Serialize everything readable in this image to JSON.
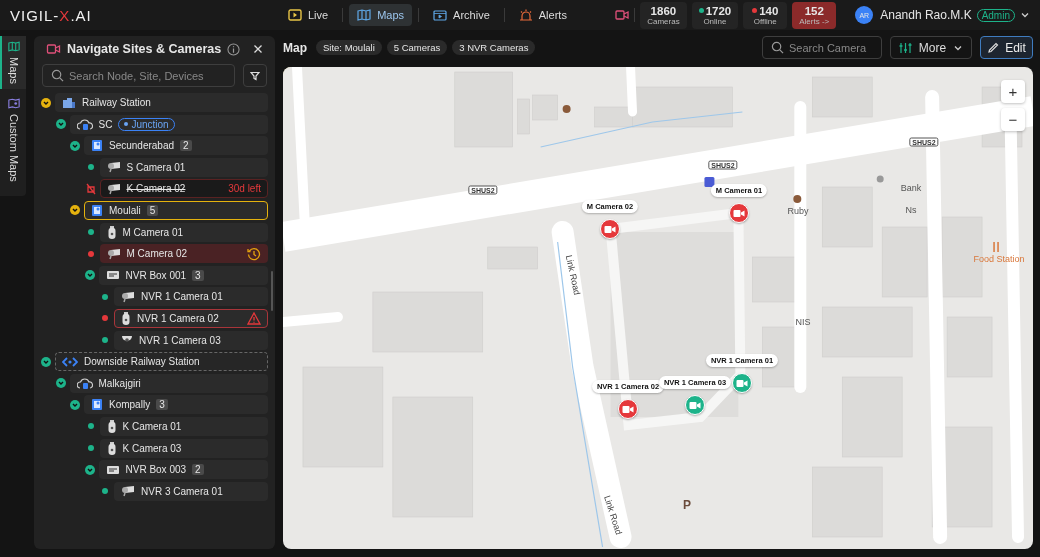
{
  "logo": {
    "before": "VIGIL-",
    "accent": "X",
    "after": ".AI"
  },
  "nav": [
    {
      "label": "Live",
      "kind": "live",
      "selected": false
    },
    {
      "label": "Maps",
      "kind": "maps",
      "selected": true
    },
    {
      "label": "Archive",
      "kind": "archive",
      "selected": false
    },
    {
      "label": "Alerts",
      "kind": "alerts",
      "selected": false
    }
  ],
  "stats": [
    {
      "value": "1860",
      "label": "Cameras",
      "kind": "total"
    },
    {
      "value": "1720",
      "label": "Online",
      "kind": "online",
      "color": "#1db38a"
    },
    {
      "value": "140",
      "label": "Offline",
      "kind": "offline",
      "color": "#e5383b"
    },
    {
      "value": "152",
      "label": "Alerts ->",
      "kind": "alerts"
    }
  ],
  "user": {
    "initials": "AR",
    "name": "Anandh Rao.M.K",
    "role": "Admin"
  },
  "rail": [
    {
      "label": "Maps",
      "kind": "maps",
      "selected": true
    },
    {
      "label": "Custom Maps",
      "kind": "custom",
      "selected": false
    }
  ],
  "panel": {
    "title": "Navigate Sites & Cameras",
    "search_placeholder": "Search Node, Site, Devices"
  },
  "tree": [
    {
      "label": "Railway Station",
      "kind": "building",
      "expanded": true,
      "selected": false,
      "color": "#e5b20e",
      "children": [
        {
          "label": "SC",
          "kind": "cloud",
          "tag": "Junction",
          "expanded": true,
          "selected": false,
          "color": "#1db38a",
          "children": [
            {
              "label": "Secunderabad",
              "kind": "zone",
              "count": "2",
              "expanded": true,
              "selected": false,
              "color": "#1db38a",
              "children": [
                {
                  "label": "S Camera 01",
                  "kind": "bullet",
                  "online": true,
                  "disabled": false,
                  "history_alert": false,
                  "warning": false,
                  "selected": false
                },
                {
                  "label": "K Camera 02",
                  "kind": "bullet",
                  "disabled": true,
                  "history_alert": false,
                  "warning": false,
                  "note": "30d left",
                  "selected": false
                }
              ]
            },
            {
              "label": "Moulali",
              "kind": "zone",
              "count": "5",
              "expanded": true,
              "selected": true,
              "color": "#e5b20e",
              "children": [
                {
                  "label": "M Camera 01",
                  "kind": "ptz",
                  "online": true,
                  "disabled": false,
                  "history_alert": false,
                  "warning": false,
                  "selected": false
                },
                {
                  "label": "M Camera 02",
                  "kind": "bullet",
                  "online": false,
                  "disabled": false,
                  "history_alert": true,
                  "warning": false,
                  "selected": false
                },
                {
                  "label": "NVR Box 001",
                  "kind": "nvr",
                  "count": "3",
                  "expanded": true,
                  "selected": false,
                  "color": "#1db38a",
                  "children": [
                    {
                      "label": "NVR 1 Camera 01",
                      "kind": "bullet",
                      "online": true,
                      "disabled": false,
                      "history_alert": false,
                      "warning": false,
                      "selected": false
                    },
                    {
                      "label": "NVR 1 Camera 02",
                      "kind": "ptz",
                      "online": false,
                      "disabled": false,
                      "history_alert": false,
                      "warning": true,
                      "selected": false
                    },
                    {
                      "label": "NVR 1 Camera 03",
                      "kind": "dome",
                      "online": true,
                      "disabled": false,
                      "history_alert": false,
                      "warning": false,
                      "selected": false
                    }
                  ]
                }
              ]
            }
          ]
        }
      ]
    },
    {
      "label": "Downside Railway Station",
      "kind": "link",
      "expanded": true,
      "selected": false,
      "color": "#1db38a",
      "children": [
        {
          "label": "Malkajgiri",
          "kind": "cloud",
          "expanded": true,
          "selected": false,
          "color": "#1db38a",
          "children": [
            {
              "label": "Kompally",
              "kind": "zone",
              "count": "3",
              "expanded": true,
              "selected": false,
              "color": "#1db38a",
              "children": [
                {
                  "label": "K Camera 01",
                  "kind": "ptz",
                  "online": true,
                  "disabled": false,
                  "history_alert": false,
                  "warning": false,
                  "selected": false
                },
                {
                  "label": "K Camera 03",
                  "kind": "ptz",
                  "online": true,
                  "disabled": false,
                  "history_alert": false,
                  "warning": false,
                  "selected": false
                },
                {
                  "label": "NVR Box 003",
                  "kind": "nvr",
                  "count": "2",
                  "expanded": true,
                  "selected": false,
                  "color": "#1db38a",
                  "children": [
                    {
                      "label": "NVR 3 Camera 01",
                      "kind": "bullet",
                      "online": true,
                      "disabled": false,
                      "history_alert": false,
                      "warning": false,
                      "selected": false
                    }
                  ]
                }
              ]
            }
          ]
        }
      ]
    }
  ],
  "map": {
    "title": "Map",
    "chips": [
      "Site: Moulali",
      "5 Cameras",
      "3 NVR Cameras"
    ],
    "search_placeholder": "Search Camera",
    "more": "More",
    "edit": "Edit",
    "zoom_in": "+",
    "zoom_out": "−",
    "pins": [
      {
        "label": "M Camera 02",
        "online": false
      },
      {
        "label": "M Camera 01",
        "online": false
      },
      {
        "label": "NVR 1 Camera 02",
        "online": false
      },
      {
        "label": "NVR 1 Camera 03",
        "online": true
      },
      {
        "label": "NVR 1 Camera 01",
        "online": true
      }
    ],
    "labels": [
      {
        "text": "SHUS2",
        "kind": "shield"
      },
      {
        "text": "SHUS2",
        "kind": "shield"
      },
      {
        "text": "SHUS2",
        "kind": "shield"
      },
      {
        "text": "Link Road",
        "kind": "road"
      },
      {
        "text": "Link Road",
        "kind": "road"
      },
      {
        "text": "Ruby",
        "kind": "place"
      },
      {
        "text": "Bank",
        "kind": "place"
      },
      {
        "text": "Ns",
        "kind": "place"
      },
      {
        "text": "NIS",
        "kind": "place"
      },
      {
        "text": "Food Station",
        "kind": "food"
      },
      {
        "text": "P",
        "kind": "big"
      }
    ]
  }
}
